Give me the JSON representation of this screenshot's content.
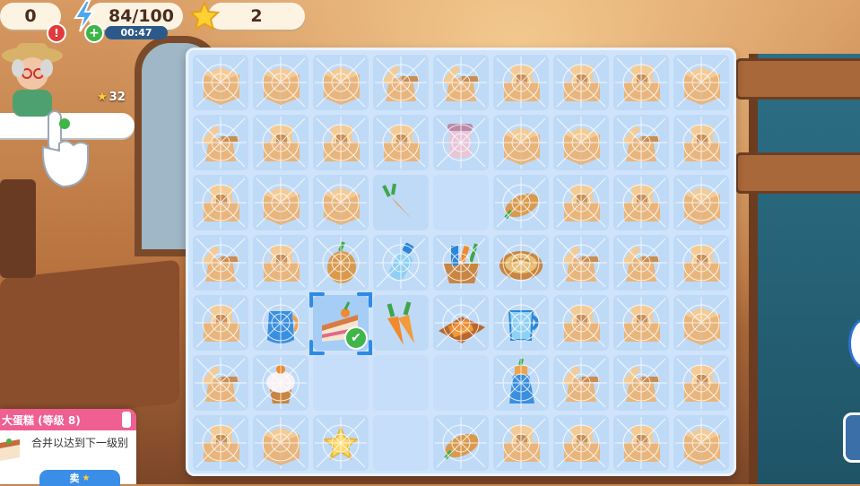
{
  "hud": {
    "coins": "0",
    "energy": "84/100",
    "energy_timer": "00:47",
    "stars": "2",
    "alert": "!",
    "plus": "+"
  },
  "quest": {
    "star_count": "32"
  },
  "board": {
    "cols": 9,
    "rows": 7,
    "grid": [
      [
        "box",
        "box",
        "box",
        "box-open",
        "box-open",
        "box-stack",
        "box-stack",
        "box-stack",
        "box"
      ],
      [
        "box-open",
        "box-stack",
        "box-stack",
        "box-stack",
        "jam-jar",
        "box",
        "box",
        "box-open",
        "box-stack"
      ],
      [
        "box-stack",
        "box",
        "box",
        "carrot",
        "empty",
        "bread",
        "box-stack",
        "box-stack",
        "box"
      ],
      [
        "box-open",
        "box-stack",
        "bread-carrot",
        "milk-bottle",
        "veggie-basket",
        "pie",
        "box-open",
        "box-open",
        "box-stack"
      ],
      [
        "box-stack",
        "juice-pitcher",
        "cake-slice",
        "carrots",
        "carrot-plate",
        "measuring-cup",
        "box-stack",
        "box-stack",
        "box"
      ],
      [
        "box-open",
        "cupcake",
        "empty",
        "empty",
        "empty",
        "spray-bottle",
        "box-open",
        "box-open",
        "box-stack"
      ],
      [
        "box-stack",
        "box",
        "star",
        "empty",
        "bread",
        "box-stack",
        "box-stack",
        "box-stack",
        "box"
      ]
    ],
    "selected": {
      "row": 4,
      "col": 2
    }
  },
  "info": {
    "title": "大蛋糕 (等级 8)",
    "description": "合并以达到下一级别",
    "sell_label": "卖",
    "check": "✔"
  },
  "colors": {
    "board_bg": "#cfe4fb",
    "cell_bg": "#bfdaf7",
    "box": "#e8b57c",
    "box_dark": "#c88e55",
    "accent_pink": "#ef5f92",
    "accent_blue": "#3b8ee8"
  }
}
